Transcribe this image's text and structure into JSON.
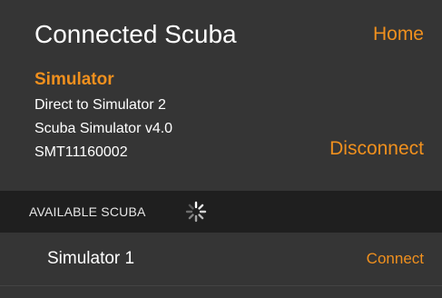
{
  "header": {
    "title": "Connected Scuba",
    "home_label": "Home"
  },
  "connected_device": {
    "name": "Simulator",
    "line1": "Direct to Simulator 2",
    "line2": "Scuba Simulator v4.0",
    "line3": "SMT11160002",
    "disconnect_label": "Disconnect"
  },
  "available_section": {
    "label": "AVAILABLE  SCUBA",
    "loading_icon": "spinner-icon"
  },
  "devices": [
    {
      "name": "Simulator 1",
      "action_label": "Connect"
    }
  ],
  "colors": {
    "accent": "#f0901e",
    "panel_background": "#353535",
    "section_bar": "#1f1f1f",
    "text": "#ffffff"
  }
}
